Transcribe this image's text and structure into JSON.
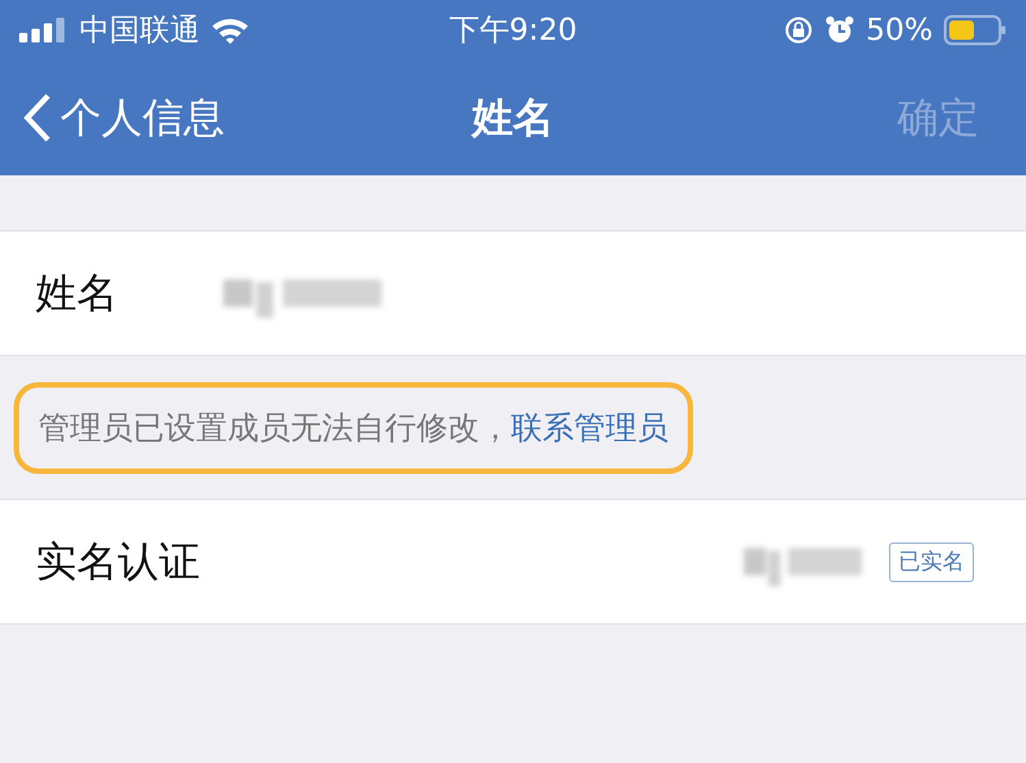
{
  "status_bar": {
    "carrier": "中国联通",
    "time": "下午9:20",
    "battery_percent": "50%"
  },
  "nav_bar": {
    "back_label": "个人信息",
    "title": "姓名",
    "action": {
      "label": "确定",
      "disabled": true
    }
  },
  "name_row": {
    "label": "姓名"
  },
  "notice": {
    "text": "管理员已设置成员无法自行修改，",
    "link": "联系管理员",
    "highlighted": true
  },
  "verification_row": {
    "label": "实名认证",
    "badge": "已实名"
  }
}
